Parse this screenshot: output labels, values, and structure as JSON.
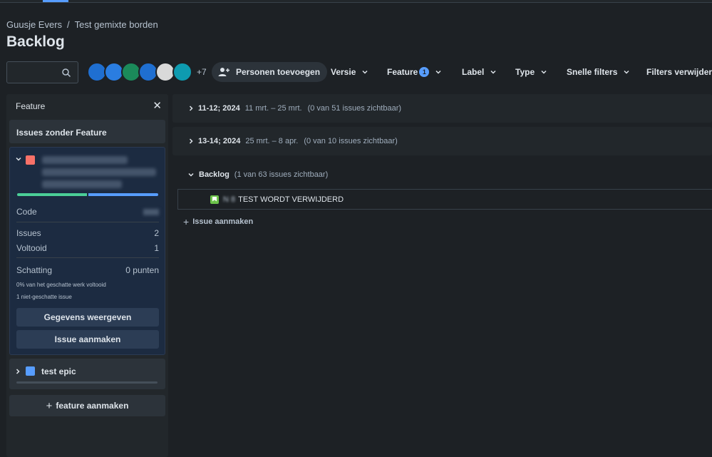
{
  "breadcrumb": {
    "items": [
      "Guusje Evers",
      "/",
      "Test gemixte borden"
    ]
  },
  "page_title": "Backlog",
  "filters": {
    "search_placeholder": "",
    "avatar_count": "+7",
    "add_people": "Personen toevoegen",
    "versie": "Versie",
    "feature": "Feature",
    "feature_badge": "1",
    "label": "Label",
    "type": "Type",
    "snelle_filters": "Snelle filters",
    "filters_verwijderen": "Filters verwijdere"
  },
  "avatars": [
    "#1f6fd1",
    "#2a7de1",
    "#1b8a5a",
    "#1f6fd1",
    "#d9d9d9",
    "#0e9bb0"
  ],
  "left_panel": {
    "title": "Feature",
    "close_icon": "close-icon",
    "no_feature": "Issues zonder Feature",
    "feature": {
      "progress_done": 0.5,
      "code_label": "Code",
      "issues_label": "Issues",
      "issues_value": "2",
      "done_label": "Voltooid",
      "done_value": "1",
      "estimate_label": "Schatting",
      "estimate_value": "0 punten",
      "estimate_note": "0% van het geschatte werk voltooid",
      "unestimated_note": "1 niet-geschatte issue",
      "details_button": "Gegevens weergeven",
      "create_issue_button": "Issue aanmaken"
    },
    "epic": {
      "label": "test epic"
    },
    "create_feature": "feature aanmaken"
  },
  "sprints": [
    {
      "name": "11-12; 2024",
      "dates": "11 mrt. – 25 mrt.",
      "count": "(0 van 51 issues zichtbaar)"
    },
    {
      "name": "13-14; 2024",
      "dates": "25 mrt. – 8 apr.",
      "count": "(0 van 10 issues zichtbaar)"
    }
  ],
  "backlog": {
    "name": "Backlog",
    "count": "(1 van 63 issues zichtbaar)",
    "issue": {
      "key": "N   8",
      "summary": "TEST WORDT VERWIJDERD"
    },
    "create_issue": "Issue aanmaken"
  },
  "colors": {
    "background": "#1d2125",
    "panel": "#22272b",
    "accent": "#579dff",
    "feature": "#f87168",
    "story": "#6cc24a"
  }
}
